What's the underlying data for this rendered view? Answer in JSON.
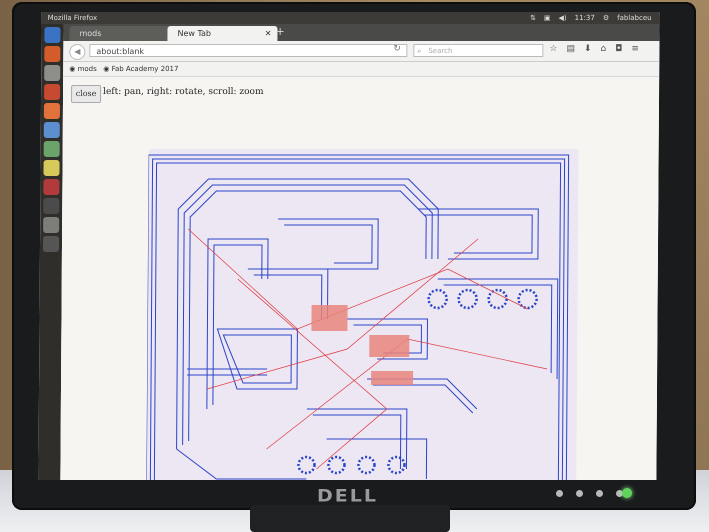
{
  "topbar": {
    "title": "Mozilla Firefox",
    "time": "11:37",
    "user": "fablabceu",
    "icons": [
      "network-icon",
      "keyboard-icon",
      "volume-icon",
      "gear-icon"
    ]
  },
  "tabs": [
    {
      "label": "mods",
      "active": false
    },
    {
      "label": "New Tab",
      "active": true
    }
  ],
  "new_tab_label": "+",
  "url": "about:blank",
  "search_placeholder": "Search",
  "bookmarks": [
    "mods",
    "Fab Academy 2017"
  ],
  "page": {
    "close_label": "close",
    "hint": "left: pan, right: rotate, scroll: zoom"
  },
  "monitor": {
    "brand": "DELL",
    "power_led_color": "#5fd35a"
  },
  "colors": {
    "trace": "#2a44c8",
    "path": "#e0393e",
    "highlight": "#e9857d"
  }
}
